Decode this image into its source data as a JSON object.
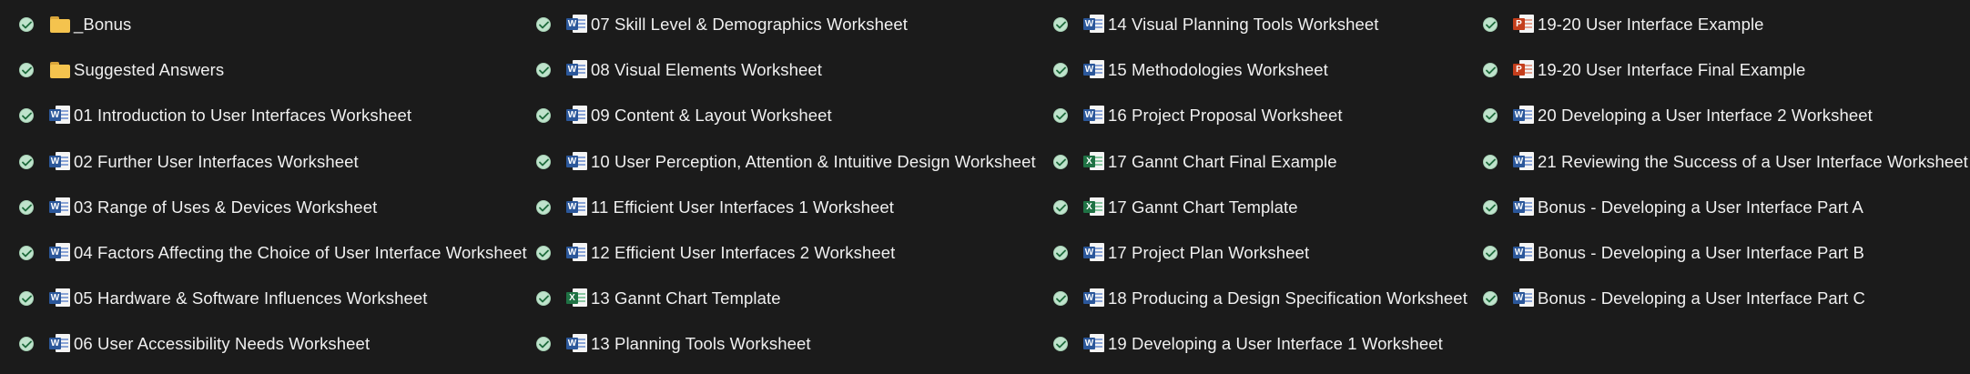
{
  "columns": [
    {
      "items": [
        {
          "type": "folder",
          "name": "_Bonus"
        },
        {
          "type": "folder",
          "name": "Suggested Answers"
        },
        {
          "type": "word",
          "name": "01 Introduction to User Interfaces Worksheet"
        },
        {
          "type": "word",
          "name": "02 Further User Interfaces Worksheet"
        },
        {
          "type": "word",
          "name": "03 Range of Uses & Devices Worksheet"
        },
        {
          "type": "word",
          "name": "04 Factors Affecting the Choice of User Interface Worksheet"
        },
        {
          "type": "word",
          "name": "05 Hardware & Software Influences Worksheet"
        },
        {
          "type": "word",
          "name": "06 User Accessibility Needs Worksheet"
        }
      ]
    },
    {
      "items": [
        {
          "type": "word",
          "name": "07 Skill Level & Demographics Worksheet"
        },
        {
          "type": "word",
          "name": "08 Visual Elements Worksheet"
        },
        {
          "type": "word",
          "name": "09 Content & Layout Worksheet"
        },
        {
          "type": "word",
          "name": "10 User Perception, Attention & Intuitive Design Worksheet"
        },
        {
          "type": "word",
          "name": "11 Efficient User Interfaces 1 Worksheet"
        },
        {
          "type": "word",
          "name": "12 Efficient User Interfaces 2 Worksheet"
        },
        {
          "type": "excel",
          "name": "13 Gannt Chart Template"
        },
        {
          "type": "word",
          "name": "13 Planning Tools Worksheet"
        }
      ]
    },
    {
      "items": [
        {
          "type": "word",
          "name": "14 Visual Planning Tools Worksheet"
        },
        {
          "type": "word",
          "name": "15 Methodologies Worksheet"
        },
        {
          "type": "word",
          "name": "16 Project Proposal Worksheet"
        },
        {
          "type": "excel",
          "name": "17 Gannt Chart Final Example"
        },
        {
          "type": "excel",
          "name": "17 Gannt Chart Template"
        },
        {
          "type": "word",
          "name": "17 Project Plan Worksheet"
        },
        {
          "type": "word",
          "name": "18 Producing a Design Specification Worksheet"
        },
        {
          "type": "word",
          "name": "19 Developing a User Interface 1 Worksheet"
        }
      ]
    },
    {
      "items": [
        {
          "type": "ppt",
          "name": "19-20 User Interface Example"
        },
        {
          "type": "ppt",
          "name": "19-20 User Interface Final Example"
        },
        {
          "type": "word",
          "name": "20 Developing a User Interface 2 Worksheet"
        },
        {
          "type": "word",
          "name": "21 Reviewing the Success of a  User Interface Worksheet"
        },
        {
          "type": "word",
          "name": "Bonus - Developing a User Interface Part A"
        },
        {
          "type": "word",
          "name": "Bonus - Developing a User Interface Part B"
        },
        {
          "type": "word",
          "name": "Bonus - Developing a User Interface Part C"
        }
      ]
    }
  ],
  "icons": {
    "status": "sync-check-icon",
    "folder": "folder-icon",
    "word": "word-document-icon",
    "excel": "excel-workbook-icon",
    "ppt": "powerpoint-presentation-icon"
  },
  "badge_letters": {
    "word": "W",
    "excel": "X",
    "ppt": "P"
  },
  "colors": {
    "background": "#1b1b1b",
    "text": "#f0f0f0",
    "check_fill": "#bfe3cc",
    "check_mark": "#1e6b3c",
    "folder": "#f4c34e",
    "word": "#2b579a",
    "excel": "#1f7244",
    "ppt": "#c43e1c"
  }
}
